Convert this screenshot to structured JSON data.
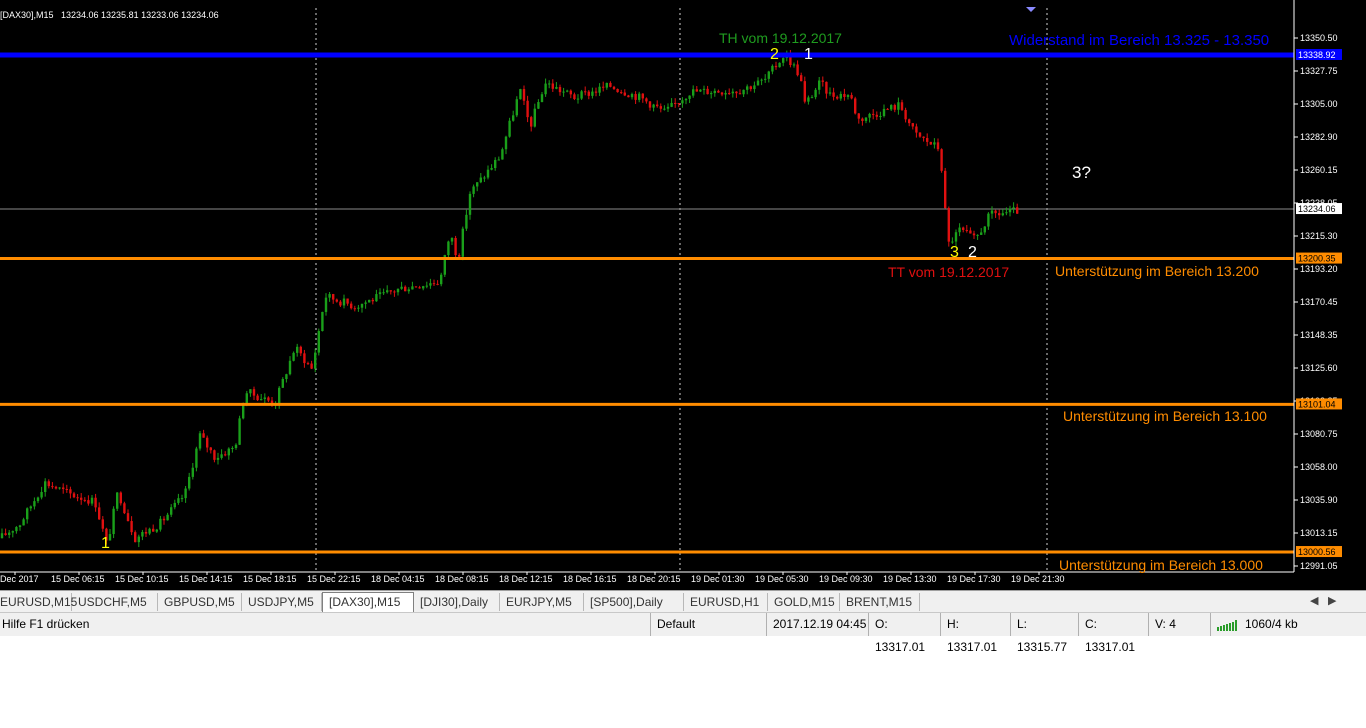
{
  "header": {
    "symbol_info": "[DAX30],M15",
    "ohlc": "13234.06 13235.81 13233.06 13234.06"
  },
  "price_axis": {
    "labels": [
      "13350.50",
      "13327.75",
      "13305.00",
      "13282.90",
      "13260.15",
      "13238.05",
      "13215.30",
      "13193.20",
      "13170.45",
      "13148.35",
      "13125.60",
      "13102.85",
      "13080.75",
      "13058.00",
      "13035.90",
      "13013.15",
      "12991.05"
    ],
    "current_price": "13234.06",
    "level_labels": {
      "resistance": "13338.92",
      "s13200": "13200.35",
      "s13100": "13101.04",
      "s13000": "13000.56"
    }
  },
  "time_axis": {
    "labels": [
      "Dec 2017",
      "15 Dec 06:15",
      "15 Dec 10:15",
      "15 Dec 14:15",
      "15 Dec 18:15",
      "15 Dec 22:15",
      "18 Dec 04:15",
      "18 Dec 08:15",
      "18 Dec 12:15",
      "18 Dec 16:15",
      "18 Dec 20:15",
      "19 Dec 01:30",
      "19 Dec 05:30",
      "19 Dec 09:30",
      "19 Dec 13:30",
      "19 Dec 17:30",
      "19 Dec 21:30"
    ]
  },
  "annotations": {
    "resistance": "Widerstand im Bereich 13.325 - 13.350",
    "th": "TH vom 19.12.2017",
    "tt": "TT vom 19.12.2017",
    "support_13200": "Unterstützung im Bereich 13.200",
    "support_13100": "Unterstützung im Bereich 13.100",
    "support_13000": "Unterstützung im Bereich 13.000",
    "question": "3?",
    "wave_low_1": "1",
    "wave_top_2": "2",
    "wave_top_1": "1",
    "wave_bottom_3": "3",
    "wave_bottom_2": "2"
  },
  "colors": {
    "background": "#000000",
    "bull_candle": "#1aa01a",
    "bear_candle": "#e01010",
    "resistance_line": "#0000ff",
    "support_line": "#ff8c00",
    "th_text": "#1f9c1f",
    "tt_text": "#e01010",
    "wave_yellow": "#ffff00",
    "wave_white": "#ffffff"
  },
  "tabs": [
    "EURUSD,M15",
    "USDCHF,M5",
    "GBPUSD,M5",
    "USDJPY,M5",
    "[DAX30],M15",
    "[DJI30],Daily",
    "EURJPY,M5",
    "[SP500],Daily",
    "EURUSD,H1",
    "GOLD,M15",
    "BRENT,M15"
  ],
  "active_tab": "[DAX30],M15",
  "status_bar": {
    "help": "Hilfe F1 drücken",
    "profile": "Default",
    "datetime": "2017.12.19 04:45",
    "open": "O: 13317.01",
    "high": "H: 13317.01",
    "low": "L: 13315.77",
    "close": "C: 13317.01",
    "volume": "V: 4",
    "traffic": "1060/4 kb"
  }
}
